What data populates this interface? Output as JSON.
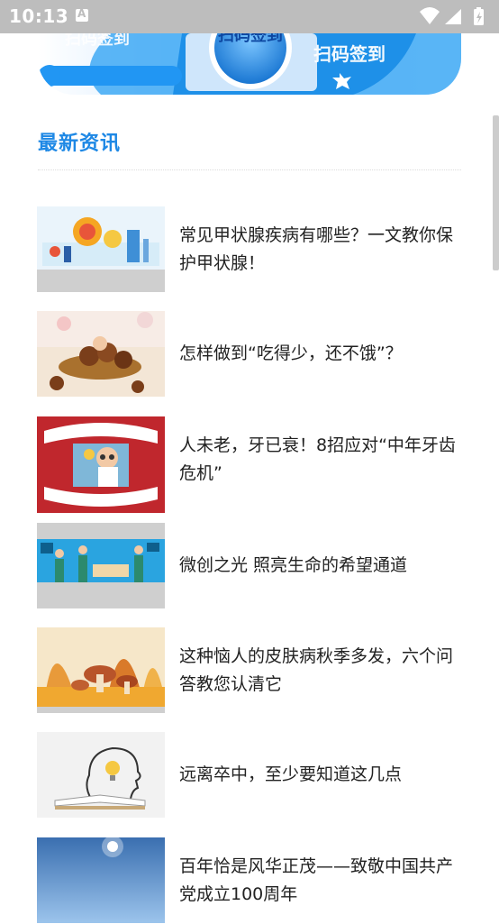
{
  "status_bar": {
    "time": "10:13",
    "icons": [
      "notification-a-icon",
      "wifi-icon",
      "signal-icon",
      "battery-icon"
    ]
  },
  "banner": {
    "left_text": "扫码签到",
    "center_text": "扫码签到",
    "right_text": "扫码签到"
  },
  "section": {
    "title": "最新资讯"
  },
  "news": [
    {
      "title": "常见甲状腺疾病有哪些？一文教你保护甲状腺！",
      "thumb": "thyroid-illustration"
    },
    {
      "title": "怎样做到“吃得少，还不饿”？",
      "thumb": "chestnuts-photo"
    },
    {
      "title": "人未老，牙已衰！8招应对“中年牙齿危机”",
      "thumb": "dentist-teeth-illustration"
    },
    {
      "title": "微创之光 照亮生命的希望通道",
      "thumb": "surgery-team-illustration"
    },
    {
      "title": "这种恼人的皮肤病秋季多发，六个问答教您认清它",
      "thumb": "autumn-mushrooms-illustration"
    },
    {
      "title": "远离卒中，至少要知道这几点",
      "thumb": "head-lightbulb-book-illustration"
    },
    {
      "title": "百年恰是风华正茂——致敬中国共产党成立100周年",
      "thumb": "sky-sun-photo"
    }
  ],
  "colors": {
    "accent": "#1e88e5",
    "status_bar": "#bdbdbd",
    "text": "#222222"
  }
}
